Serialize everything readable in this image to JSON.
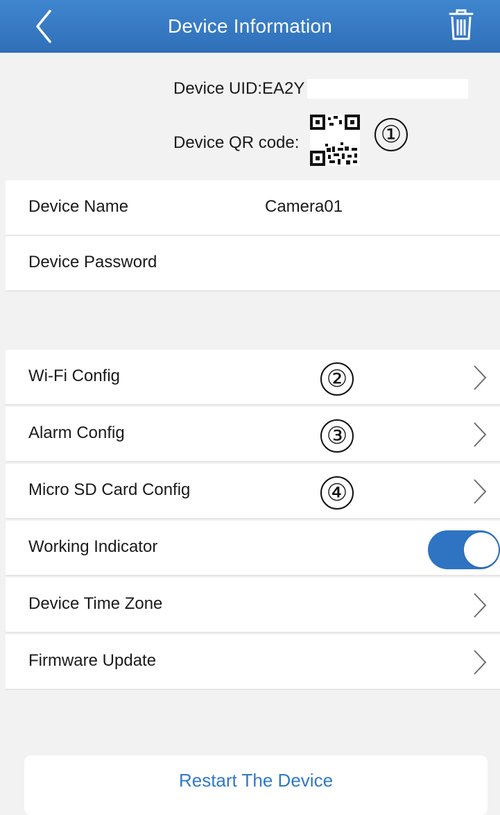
{
  "navbar": {
    "title": "Device Information",
    "back_icon": "chevron-left-icon",
    "delete_icon": "trash-icon",
    "bg_color": "#3578c4"
  },
  "device_info": {
    "uid_label": "Device UID:EA2Y",
    "qr_label": "Device QR code:",
    "annotation": "①"
  },
  "fields": {
    "name_label": "Device Name",
    "name_value": "Camera01",
    "password_label": "Device Password"
  },
  "settings": {
    "wifi_label": "Wi-Fi Config",
    "wifi_annotation": "②",
    "alarm_label": "Alarm Config",
    "alarm_annotation": "③",
    "sd_label": "Micro SD Card Config",
    "sd_annotation": "④",
    "indicator_label": "Working Indicator",
    "indicator_on": true,
    "timezone_label": "Device Time Zone",
    "firmware_label": "Firmware Update"
  },
  "restart": {
    "label": "Restart The Device",
    "color": "#2f78c8"
  }
}
